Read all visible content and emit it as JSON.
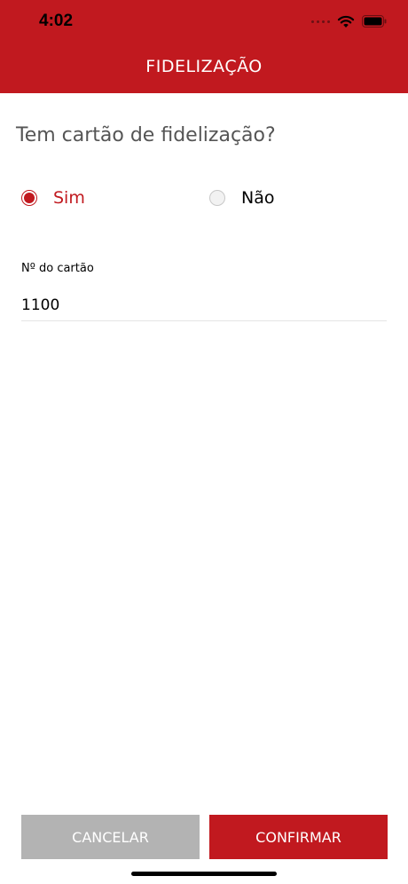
{
  "status_bar": {
    "time": "4:02"
  },
  "header": {
    "title": "FIDELIZAÇÃO"
  },
  "form": {
    "question": "Tem cartão de fidelização?",
    "options": [
      {
        "label": "Sim",
        "selected": true
      },
      {
        "label": "Não",
        "selected": false
      }
    ],
    "card_label": "Nº do cartão",
    "card_value": "1100"
  },
  "actions": {
    "cancel_label": "CANCELAR",
    "confirm_label": "CONFIRMAR"
  },
  "colors": {
    "brand": "#c1191f",
    "cancel": "#b3b3b3"
  }
}
